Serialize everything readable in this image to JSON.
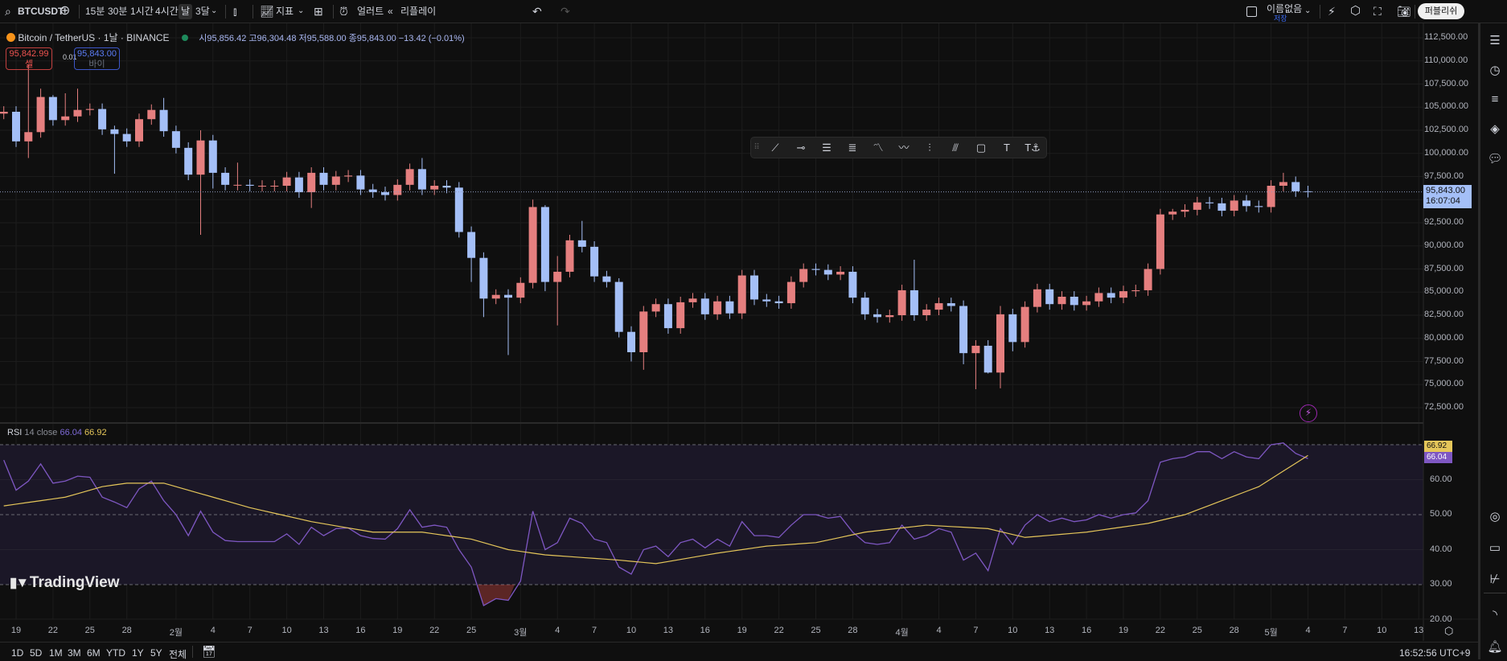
{
  "toolbar": {
    "symbol": "BTCUSDT",
    "intervals": [
      "15분",
      "30분",
      "1시간",
      "4시간",
      "날",
      "3달"
    ],
    "selected_interval": "날",
    "indicators_label": "지표",
    "alert_label": "얼러트",
    "replay_label": "리플레이",
    "layout_name": "이름없음",
    "save_label": "저장",
    "publish_label": "퍼블리쉬"
  },
  "legend": {
    "title": "Bitcoin / TetherUS · 1날 · BINANCE",
    "open_label": "시",
    "open": "95,856.42",
    "high_label": "고",
    "high": "96,304.48",
    "low_label": "저",
    "low": "95,588.00",
    "close_label": "종",
    "close": "95,843.00",
    "change": "−13.42 (−0.01%)",
    "sell_price": "95,842.99",
    "sell_label": "셀",
    "spread": "0.01",
    "buy_price": "95,843.00",
    "buy_label": "바이"
  },
  "price_axis": {
    "labels": [
      "112,500.00",
      "110,000.00",
      "107,500.00",
      "105,000.00",
      "102,500.00",
      "100,000.00",
      "97,500.00",
      "95,000.00",
      "92,500.00",
      "90,000.00",
      "87,500.00",
      "85,000.00",
      "82,500.00",
      "80,000.00",
      "77,500.00",
      "75,000.00",
      "72,500.00"
    ],
    "current_price": "95,843.00",
    "countdown": "16:07:04"
  },
  "rsi": {
    "label": "RSI",
    "params": "14 close",
    "value": "66.04",
    "ma_value": "66.92",
    "axis_labels": [
      "60.00",
      "50.00",
      "40.00",
      "30.00",
      "20.00"
    ],
    "colors": {
      "rsi": "#7e57c2",
      "ma": "#e5c65a"
    }
  },
  "time_axis": {
    "labels": [
      [
        "19",
        1
      ],
      [
        "22",
        4
      ],
      [
        "25",
        7
      ],
      [
        "28",
        10
      ],
      [
        "2월",
        14
      ],
      [
        "4",
        17
      ],
      [
        "7",
        20
      ],
      [
        "10",
        23
      ],
      [
        "13",
        26
      ],
      [
        "16",
        29
      ],
      [
        "19",
        32
      ],
      [
        "22",
        35
      ],
      [
        "25",
        38
      ],
      [
        "3월",
        42
      ],
      [
        "4",
        45
      ],
      [
        "7",
        48
      ],
      [
        "10",
        51
      ],
      [
        "13",
        54
      ],
      [
        "16",
        57
      ],
      [
        "19",
        60
      ],
      [
        "22",
        63
      ],
      [
        "25",
        66
      ],
      [
        "28",
        69
      ],
      [
        "4월",
        73
      ],
      [
        "4",
        76
      ],
      [
        "7",
        79
      ],
      [
        "10",
        82
      ],
      [
        "13",
        85
      ],
      [
        "16",
        88
      ],
      [
        "19",
        91
      ],
      [
        "22",
        94
      ],
      [
        "25",
        97
      ],
      [
        "28",
        100
      ],
      [
        "5월",
        103
      ],
      [
        "4",
        106
      ],
      [
        "7",
        109
      ],
      [
        "10",
        112
      ],
      [
        "13",
        115
      ]
    ],
    "clock": "16:52:56 UTC+9"
  },
  "range_buttons": [
    "1D",
    "5D",
    "1M",
    "3M",
    "6M",
    "YTD",
    "1Y",
    "5Y",
    "전체"
  ],
  "branding": "TradingView",
  "colors": {
    "up": "#e57f7f",
    "down": "#a4bff7",
    "background": "#0f0f0f"
  },
  "chart_data": {
    "type": "candlestick",
    "title": "Bitcoin / TetherUS · 1D · BINANCE",
    "x_start": "2025-01-18",
    "ylim": [
      70000,
      115000
    ],
    "first_open": 104300,
    "closes": [
      104.5,
      101.3,
      102.3,
      106.1,
      103.6,
      104.0,
      104.7,
      104.8,
      102.6,
      102.1,
      101.3,
      103.7,
      104.7,
      102.4,
      100.6,
      97.7,
      101.4,
      97.9,
      96.6,
      96.6,
      96.5,
      96.5,
      96.5,
      97.4,
      95.8,
      97.9,
      96.6,
      97.5,
      97.6,
      96.1,
      95.8,
      95.5,
      96.6,
      98.3,
      96.1,
      96.5,
      96.3,
      91.5,
      88.7,
      84.3,
      84.7,
      84.4,
      86.0,
      94.2,
      86.1,
      87.2,
      90.6,
      89.9,
      86.7,
      86.1,
      80.7,
      78.5,
      82.9,
      83.7,
      81.1,
      83.9,
      84.3,
      82.6,
      84.0,
      82.7,
      86.8,
      84.2,
      84.0,
      83.8,
      86.1,
      87.5,
      87.4,
      86.9,
      87.2,
      84.4,
      82.6,
      82.3,
      82.5,
      85.2,
      82.5,
      83.1,
      83.8,
      83.5,
      78.4,
      79.2,
      76.3,
      82.6,
      79.6,
      83.4,
      85.3,
      83.7,
      84.5,
      83.6,
      84.0,
      84.9,
      84.4,
      85.1,
      85.2,
      87.5,
      93.4,
      93.7,
      93.9,
      94.7,
      94.6,
      93.8,
      94.9,
      94.3,
      94.2,
      96.5,
      96.9,
      95.9,
      95.843
    ],
    "value_unit": "thousands USDT",
    "wick_default": 0.6,
    "high_overrides": {
      "2": 109.6,
      "3": 107.0,
      "4": 106.3,
      "5": 106.5,
      "6": 107.0,
      "9": 103.0,
      "13": 106.0,
      "16": 102.5,
      "19": 99.0,
      "34": 99.5,
      "43": 95.0,
      "44": 94.4,
      "45": 88.9,
      "47": 92.7,
      "50": 86.5,
      "74": 88.5,
      "81": 83.5,
      "95": 94.0,
      "104": 97.9
    },
    "low_overrides": {
      "2": 99.5,
      "9": 97.8,
      "16": 91.2,
      "17": 96.2,
      "25": 94.1,
      "38": 86.1,
      "39": 82.3,
      "41": 78.2,
      "44": 85.1,
      "45": 81.4,
      "51": 77.5,
      "52": 76.6,
      "78": 77.2,
      "79": 74.5,
      "80": 76.2,
      "81": 74.6,
      "82": 78.6
    },
    "rsi_values": [
      65.6,
      57,
      59.6,
      64.5,
      59,
      59.6,
      61,
      60.7,
      55,
      53.6,
      52,
      57.4,
      59.6,
      54,
      50,
      44,
      51,
      45,
      42.6,
      42.3,
      42.3,
      42.3,
      42.3,
      44.5,
      41.5,
      46.4,
      44,
      46,
      46.2,
      44,
      43.2,
      43,
      46,
      51.4,
      46.4,
      47,
      46.4,
      40,
      35,
      24,
      26,
      25.5,
      31,
      51,
      40,
      42,
      49,
      47.5,
      43,
      42,
      35,
      33,
      40,
      41,
      38,
      42,
      43,
      40.5,
      43,
      41,
      48,
      44,
      44,
      43.5,
      47,
      50,
      50,
      49,
      49.5,
      45,
      42,
      41.5,
      42,
      47,
      43,
      44,
      46,
      45,
      37,
      39,
      34,
      46,
      41.5,
      47,
      50,
      48,
      49,
      48,
      48.5,
      50,
      49,
      50,
      50.5,
      54,
      65,
      66,
      66.5,
      68,
      68,
      66,
      68,
      66.5,
      66,
      70,
      70.5,
      67.5,
      66.04
    ],
    "rsi_ma_keypoints": [
      [
        0,
        52.5
      ],
      [
        5,
        55
      ],
      [
        8,
        58
      ],
      [
        10,
        59
      ],
      [
        13,
        59
      ],
      [
        16,
        56
      ],
      [
        20,
        52
      ],
      [
        25,
        48
      ],
      [
        30,
        45
      ],
      [
        34,
        45
      ],
      [
        38,
        43
      ],
      [
        41,
        40
      ],
      [
        44,
        38.5
      ],
      [
        50,
        37
      ],
      [
        53,
        36
      ],
      [
        58,
        39
      ],
      [
        62,
        41
      ],
      [
        66,
        42
      ],
      [
        70,
        45
      ],
      [
        75,
        47
      ],
      [
        80,
        46
      ],
      [
        83,
        43.5
      ],
      [
        88,
        45
      ],
      [
        93,
        47.5
      ],
      [
        96,
        50
      ],
      [
        99,
        54
      ],
      [
        102,
        58
      ],
      [
        106,
        66.92
      ]
    ],
    "rsi_levels": [
      70,
      50,
      30
    ],
    "rsi_ylim": [
      20,
      75
    ]
  }
}
